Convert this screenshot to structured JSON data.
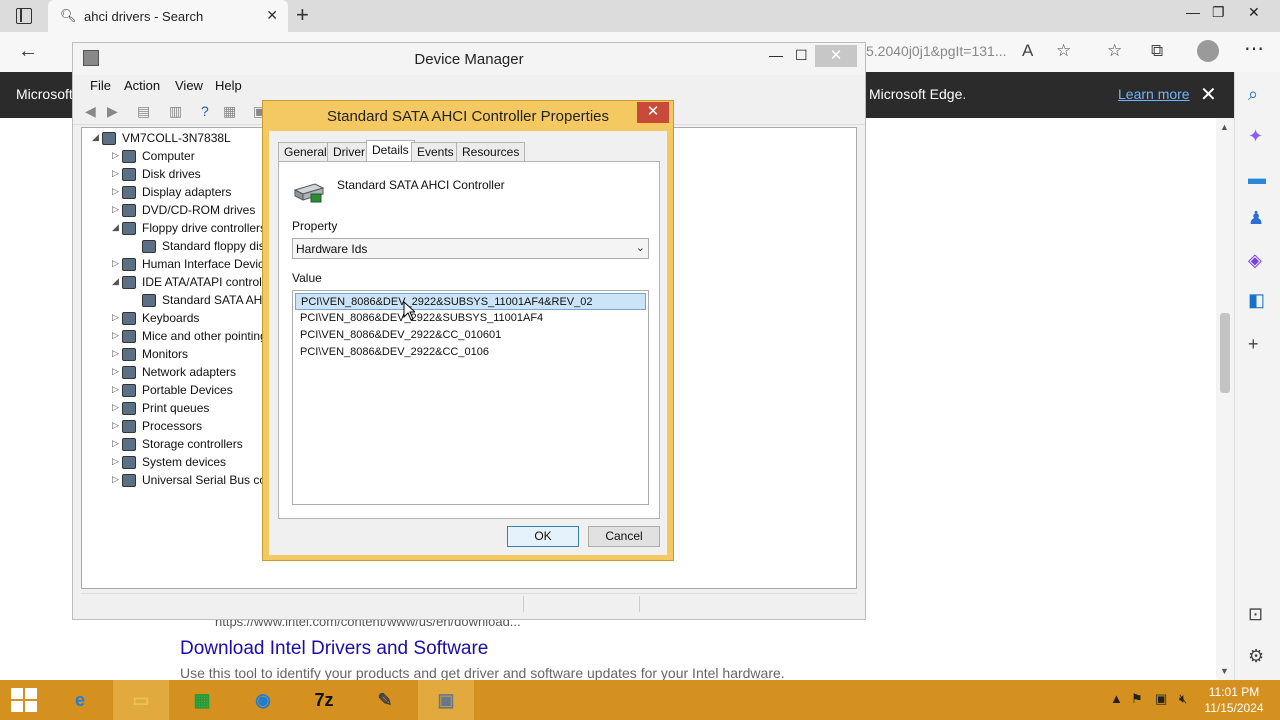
{
  "browser": {
    "tab_title": "ahci drivers - Search",
    "url_tail": "5.2040j0j1&pgIt=131...",
    "infobar_left": "Microsoft",
    "infobar_right": "Microsoft Edge.",
    "learn_more": "Learn more",
    "result_url": "https://www.intel.com/content/www/us/en/download...",
    "result_title": "Download Intel Drivers and Software",
    "result_desc": "Use this tool to identify your products and get driver and software updates for your Intel hardware."
  },
  "device_manager": {
    "title": "Device Manager",
    "menu": [
      "File",
      "Action",
      "View",
      "Help"
    ],
    "tree": [
      {
        "label": "VM7COLL-3N7838L",
        "twisty": "◢",
        "icon": "computer-root-icon"
      },
      {
        "label": "Computer",
        "twisty": "▷",
        "icon": "computer-icon"
      },
      {
        "label": "Disk drives",
        "twisty": "▷",
        "icon": "disk-drive-icon"
      },
      {
        "label": "Display adapters",
        "twisty": "▷",
        "icon": "display-adapter-icon"
      },
      {
        "label": "DVD/CD-ROM drives",
        "twisty": "▷",
        "icon": "dvd-drive-icon"
      },
      {
        "label": "Floppy drive controllers",
        "twisty": "◢",
        "icon": "floppy-controller-icon"
      },
      {
        "label": "Standard floppy disk controller",
        "twisty": "",
        "icon": "floppy-device-icon"
      },
      {
        "label": "Human Interface Devices",
        "twisty": "▷",
        "icon": "hid-icon"
      },
      {
        "label": "IDE ATA/ATAPI controllers",
        "twisty": "◢",
        "icon": "ide-controller-icon"
      },
      {
        "label": "Standard SATA AHCI Controller",
        "twisty": "",
        "icon": "sata-device-icon"
      },
      {
        "label": "Keyboards",
        "twisty": "▷",
        "icon": "keyboard-icon"
      },
      {
        "label": "Mice and other pointing devices",
        "twisty": "▷",
        "icon": "mouse-icon"
      },
      {
        "label": "Monitors",
        "twisty": "▷",
        "icon": "monitor-icon"
      },
      {
        "label": "Network adapters",
        "twisty": "▷",
        "icon": "network-adapter-icon"
      },
      {
        "label": "Portable Devices",
        "twisty": "▷",
        "icon": "portable-device-icon"
      },
      {
        "label": "Print queues",
        "twisty": "▷",
        "icon": "printer-icon"
      },
      {
        "label": "Processors",
        "twisty": "▷",
        "icon": "processor-icon"
      },
      {
        "label": "Storage controllers",
        "twisty": "▷",
        "icon": "storage-controller-icon"
      },
      {
        "label": "System devices",
        "twisty": "▷",
        "icon": "system-device-icon"
      },
      {
        "label": "Universal Serial Bus controllers",
        "twisty": "▷",
        "icon": "usb-icon"
      }
    ]
  },
  "dialog": {
    "title": "Standard SATA AHCI Controller Properties",
    "tabs": [
      "General",
      "Driver",
      "Details",
      "Events",
      "Resources"
    ],
    "active_tab": "Details",
    "device_name": "Standard SATA AHCI Controller",
    "property_label": "Property",
    "property_value": "Hardware Ids",
    "value_label": "Value",
    "values": [
      "PCI\\VEN_8086&DEV_2922&SUBSYS_11001AF4&REV_02",
      "PCI\\VEN_8086&DEV_2922&SUBSYS_11001AF4",
      "PCI\\VEN_8086&DEV_2922&CC_010601",
      "PCI\\VEN_8086&DEV_2922&CC_0106"
    ],
    "selected_value_index": 0,
    "ok": "OK",
    "cancel": "Cancel"
  },
  "taskbar": {
    "apps": [
      {
        "name": "internet-explorer-icon",
        "glyph": "e",
        "color": "#1e7fd6"
      },
      {
        "name": "file-explorer-icon",
        "glyph": "▭",
        "color": "#e8c35a"
      },
      {
        "name": "store-icon",
        "glyph": "▦",
        "color": "#1b9e3e"
      },
      {
        "name": "edge-icon",
        "glyph": "◉",
        "color": "#1a7fd4"
      },
      {
        "name": "7zip-icon",
        "glyph": "7z",
        "color": "#111111"
      },
      {
        "name": "tool-icon",
        "glyph": "✎",
        "color": "#444444"
      },
      {
        "name": "device-manager-icon",
        "glyph": "▣",
        "color": "#667788"
      }
    ],
    "time": "11:01 PM",
    "date": "11/15/2024"
  },
  "colors": {
    "taskbar": "#d49120",
    "dialog_frame": "#f5c962",
    "close_red": "#c94a3b",
    "link": "#1a0dab"
  }
}
